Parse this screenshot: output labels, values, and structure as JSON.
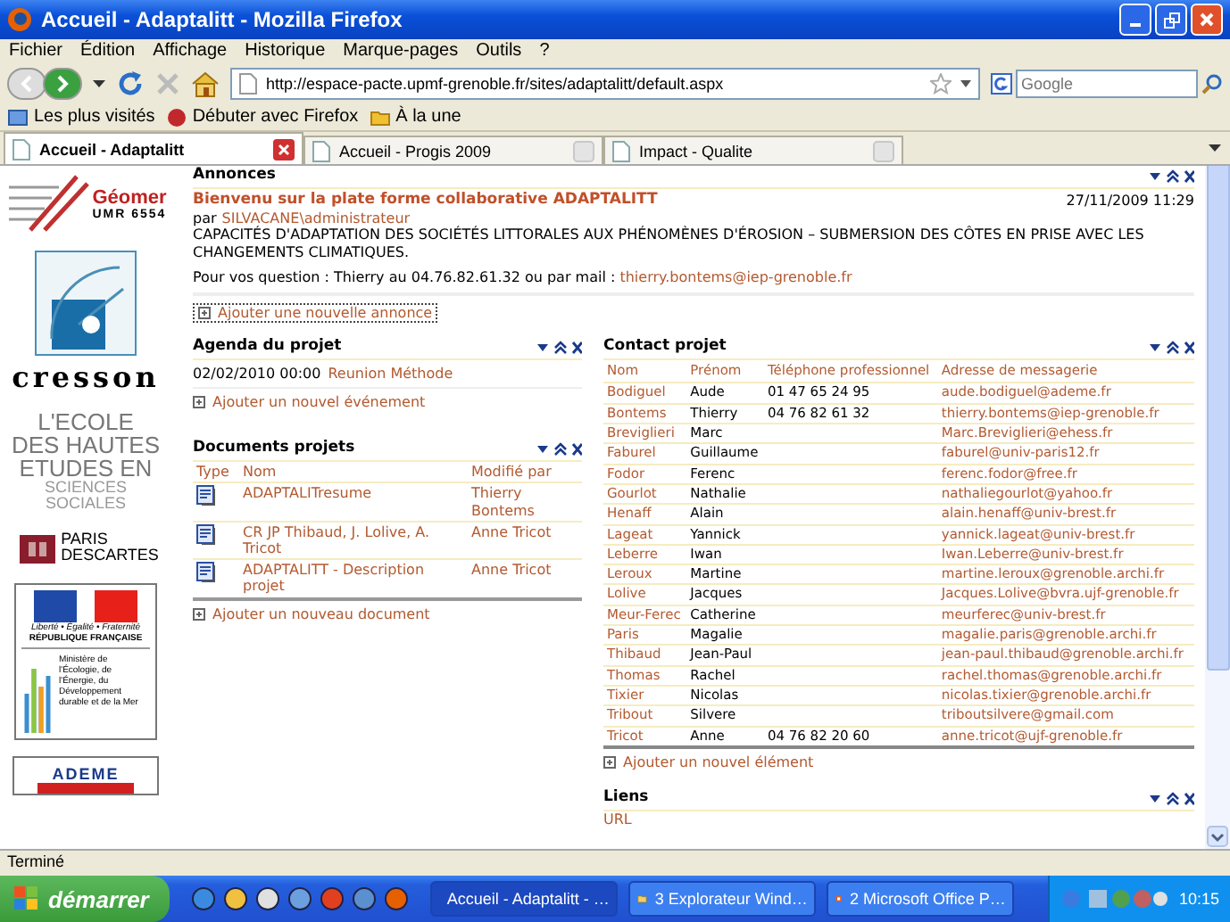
{
  "window": {
    "title": "Accueil - Adaptalitt - Mozilla Firefox"
  },
  "menu": [
    "Fichier",
    "Édition",
    "Affichage",
    "Historique",
    "Marque-pages",
    "Outils",
    "?"
  ],
  "navigation": {
    "url": "http://espace-pacte.upmf-grenoble.fr/sites/adaptalitt/default.aspx",
    "search_placeholder": "Google"
  },
  "bookmarks": [
    "Les plus visités",
    "Débuter avec Firefox",
    "À la une"
  ],
  "tabs": [
    {
      "label": "Accueil - Adaptalitt",
      "selected": true
    },
    {
      "label": "Accueil - Progis 2009",
      "selected": false
    },
    {
      "label": "Impact - Qualite",
      "selected": false
    }
  ],
  "logos": [
    {
      "kind": "geomer",
      "lines": [
        "Géomer",
        "UMR 6554"
      ]
    },
    {
      "kind": "cresson",
      "lines": [
        "cresson"
      ]
    },
    {
      "kind": "ehess",
      "lines": [
        "L'ECOLE",
        "DES HAUTES",
        "ETUDES EN",
        "SCIENCES",
        "SOCIALES"
      ]
    },
    {
      "kind": "descartes",
      "lines": [
        "PARIS",
        "DESCARTES"
      ]
    },
    {
      "kind": "republique",
      "lines": [
        "Liberté • Égalité • Fraternité",
        "RÉPUBLIQUE FRANÇAISE",
        "Ministère de l'Écologie, de l'Énergie, du Développement durable et de la Mer"
      ]
    },
    {
      "kind": "ademe",
      "lines": [
        "ADEME"
      ]
    }
  ],
  "announcements": {
    "title": "Annonces",
    "item": {
      "title": "Bienvenu sur la plate forme collaborative ADAPTALITT",
      "date": "27/11/2009 11:29",
      "by": "par",
      "author": "SILVACANE\\administrateur",
      "body": "CAPACITÉS D'ADAPTATION DES SOCIÉTÉS LITTORALES AUX PHÉNOMÈNES D'ÉROSION – SUBMERSION DES CÔTES EN PRISE AVEC LES CHANGEMENTS CLIMATIQUES.",
      "contact_text": "Pour vos question : Thierry au 04.76.82.61.32 ou par mail : ",
      "contact_email": "thierry.bontems@iep-grenoble.fr"
    },
    "add_link": "Ajouter une nouvelle annonce"
  },
  "agenda": {
    "title": "Agenda du projet",
    "events": [
      {
        "date": "02/02/2010 00:00",
        "title": "Reunion Méthode"
      }
    ],
    "add_link": "Ajouter un nouvel événement"
  },
  "documents": {
    "title": "Documents projets",
    "columns": [
      "Type",
      "Nom",
      "Modifié par"
    ],
    "rows": [
      {
        "name": "ADAPTALITresume",
        "modified_by": "Thierry Bontems"
      },
      {
        "name": "CR JP Thibaud, J. Lolive, A. Tricot",
        "modified_by": "Anne Tricot"
      },
      {
        "name": "ADAPTALITT - Description projet",
        "modified_by": "Anne Tricot"
      }
    ],
    "add_link": "Ajouter un nouveau document"
  },
  "contacts": {
    "title": "Contact projet",
    "columns": [
      "Nom",
      "Prénom",
      "Téléphone professionnel",
      "Adresse de messagerie"
    ],
    "rows": [
      [
        "Bodiguel",
        "Aude",
        "01 47 65 24 95",
        "aude.bodiguel@ademe.fr"
      ],
      [
        "Bontems",
        "Thierry",
        "04 76 82 61 32",
        "thierry.bontems@iep-grenoble.fr"
      ],
      [
        "Breviglieri",
        "Marc",
        "",
        "Marc.Breviglieri@ehess.fr"
      ],
      [
        "Faburel",
        "Guillaume",
        "",
        "faburel@univ-paris12.fr"
      ],
      [
        "Fodor",
        "Ferenc",
        "",
        "ferenc.fodor@free.fr"
      ],
      [
        "Gourlot",
        "Nathalie",
        "",
        "nathaliegourlot@yahoo.fr"
      ],
      [
        "Henaff",
        "Alain",
        "",
        "alain.henaff@univ-brest.fr"
      ],
      [
        "Lageat",
        "Yannick",
        "",
        "yannick.lageat@univ-brest.fr"
      ],
      [
        "Leberre",
        "Iwan",
        "",
        "Iwan.Leberre@univ-brest.fr"
      ],
      [
        "Leroux",
        "Martine",
        "",
        "martine.leroux@grenoble.archi.fr"
      ],
      [
        "Lolive",
        "Jacques",
        "",
        "Jacques.Lolive@bvra.ujf-grenoble.fr"
      ],
      [
        "Meur-Ferec",
        "Catherine",
        "",
        "meurferec@univ-brest.fr"
      ],
      [
        "Paris",
        "Magalie",
        "",
        "magalie.paris@grenoble.archi.fr"
      ],
      [
        "Thibaud",
        "Jean-Paul",
        "",
        "jean-paul.thibaud@grenoble.archi.fr"
      ],
      [
        "Thomas",
        "Rachel",
        "",
        "rachel.thomas@grenoble.archi.fr"
      ],
      [
        "Tixier",
        "Nicolas",
        "",
        "nicolas.tixier@grenoble.archi.fr"
      ],
      [
        "Tribout",
        "Silvere",
        "",
        "triboutsilvere@gmail.com"
      ],
      [
        "Tricot",
        "Anne",
        "04 76 82 20 60",
        "anne.tricot@ujf-grenoble.fr"
      ]
    ],
    "add_link": "Ajouter un nouvel élément"
  },
  "links": {
    "title": "Liens",
    "column": "URL"
  },
  "status_bar": {
    "text": "Terminé"
  },
  "taskbar": {
    "start": "démarrer",
    "tasks": [
      {
        "label": "Accueil - Adaptalitt - …",
        "selected": true
      },
      {
        "label": "3 Explorateur Wind…",
        "selected": false
      },
      {
        "label": "2 Microsoft Office P…",
        "selected": false
      }
    ],
    "clock": "10:15"
  }
}
